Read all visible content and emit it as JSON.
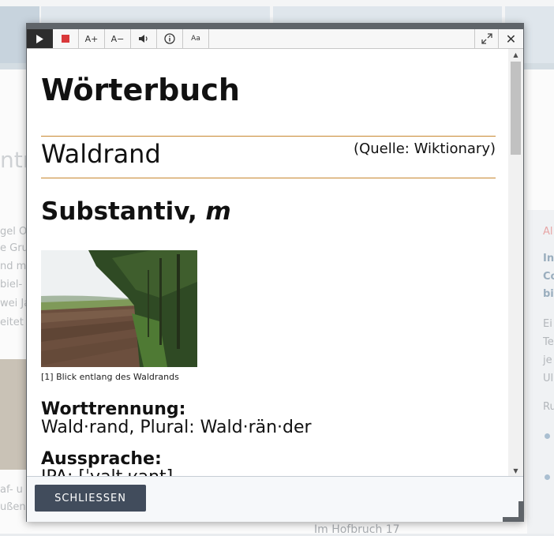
{
  "background": {
    "left_snippets": [
      "gel O",
      "e Gru",
      "nd m",
      "biel- u",
      "wei Ja",
      "eitet"
    ],
    "left_heading": "ntr",
    "left_bottom_snippets": [
      "af- u",
      "ußen"
    ],
    "right_red": "Al",
    "right_bold": [
      "In",
      "Co",
      "bi"
    ],
    "right_text": [
      "Ei",
      "Te",
      "je",
      "Ul",
      "Ru"
    ],
    "bottom_text": "Im Hofbruch 17"
  },
  "toolbar": {
    "play_icon": "play-icon",
    "stop_icon": "stop-icon",
    "font_increase_label": "A+",
    "font_decrease_label": "A−",
    "volume_icon": "volume-icon",
    "info_icon": "info-icon",
    "font_settings_label": "Aa",
    "expand_icon": "expand-icon",
    "close_label": "✕",
    "stop_color": "#d9383a"
  },
  "dictionary": {
    "title": "Wörterbuch",
    "word": "Waldrand",
    "source": "(Quelle: Wiktionary)",
    "part_of_speech": "Substantiv,",
    "gender": "m",
    "image_caption": "[1] Blick entlang des Waldrands",
    "hyphenation_heading": "Worttrennung:",
    "hyphenation_text": "Wald·rand, Plural: Wald·rän·der",
    "pronunciation_heading": "Aussprache:",
    "pronunciation_text": "IPA: [ˈvaltˌʁant]"
  },
  "footer": {
    "close_button_label": "SCHLIESSEN"
  },
  "colors": {
    "accent_rule": "#c8872f",
    "button_bg": "#414c5c",
    "frame": "#5f6469"
  }
}
